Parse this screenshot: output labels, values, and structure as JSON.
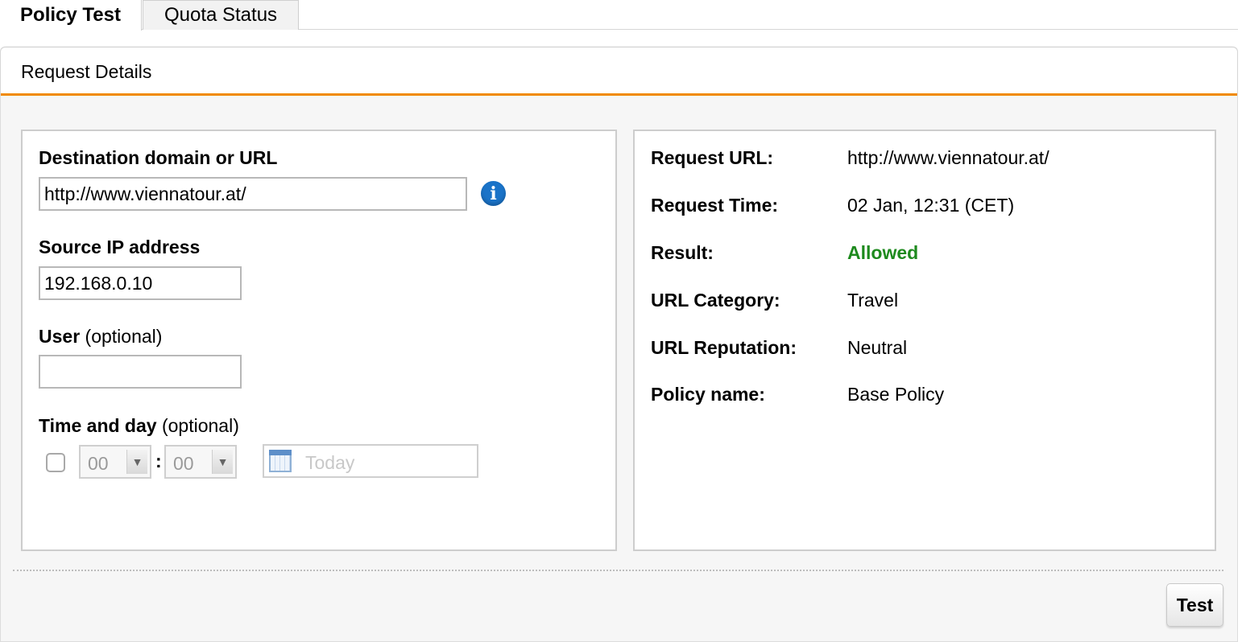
{
  "tabs": [
    {
      "label": "Policy Test",
      "active": true
    },
    {
      "label": "Quota Status",
      "active": false
    }
  ],
  "panel": {
    "title": "Request Details"
  },
  "form": {
    "destination": {
      "label": "Destination domain or URL",
      "value": "http://www.viennatour.at/",
      "icon": "info-icon"
    },
    "source_ip": {
      "label": "Source IP address",
      "value": "192.168.0.10"
    },
    "user": {
      "label": "User",
      "optional": "(optional)",
      "value": ""
    },
    "time": {
      "label": "Time and day",
      "optional": "(optional)",
      "enabled": false,
      "hour": "00",
      "minute": "00",
      "separator": ":",
      "date_placeholder": "Today",
      "date_icon": "calendar-icon"
    }
  },
  "details": [
    {
      "label": "Request URL:",
      "value": "http://www.viennatour.at/"
    },
    {
      "label": "Request Time:",
      "value": "02 Jan, 12:31 (CET)"
    },
    {
      "label": "Result:",
      "value": "Allowed"
    },
    {
      "label": "URL Category:",
      "value": "Travel"
    },
    {
      "label": "URL Reputation:",
      "value": "Neutral"
    },
    {
      "label": "Policy name:",
      "value": "Base Policy"
    }
  ],
  "actions": {
    "test_label": "Test"
  },
  "colors": {
    "accent": "#f08a00",
    "allowed": "#1e8a1e",
    "info": "#1a73c8"
  }
}
